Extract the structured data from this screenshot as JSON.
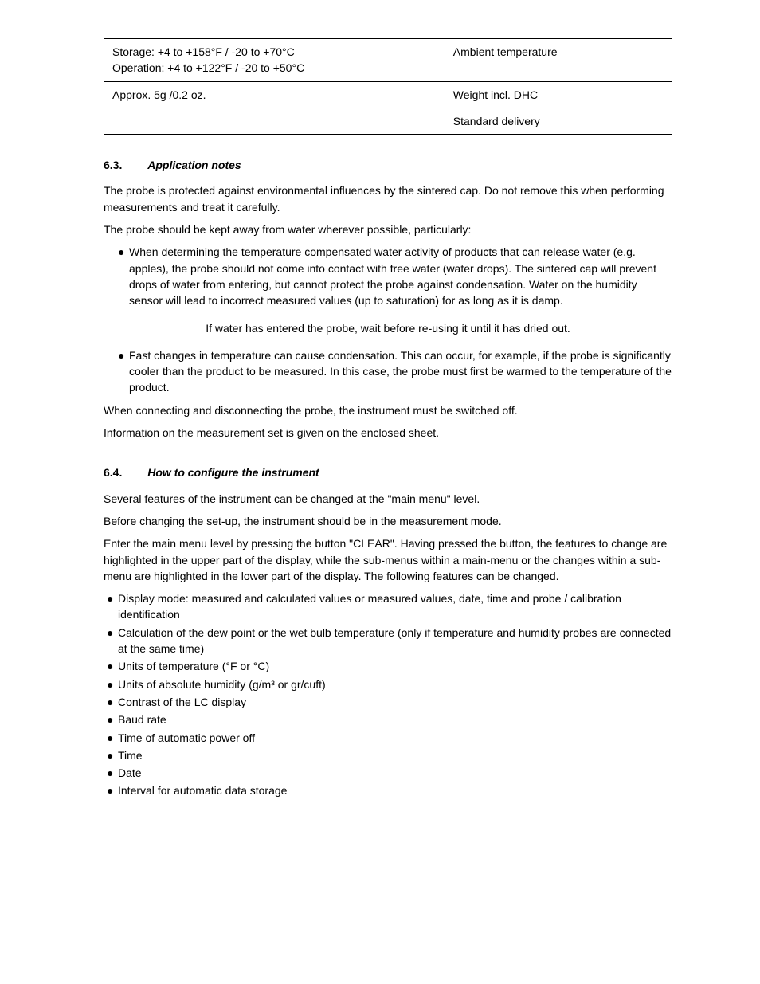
{
  "table": {
    "rows": [
      {
        "left": "Storage: +4 to +158°F / -20 to +70°C\nOperation: +4 to +122°F / -20 to +50°C",
        "right": "Ambient temperature",
        "leftRowspan": 1,
        "rightRowspan": 1
      },
      {
        "left": "Approx. 5g /0.2 oz.",
        "right": "Weight incl. DHC",
        "leftRowspan": 2
      },
      {
        "right": "Standard delivery"
      }
    ]
  },
  "sections": [
    {
      "num": "6.3.",
      "title": "Application notes",
      "paras": [
        "The probe is protected against environmental influences by the sintered cap. Do not remove this when performing measurements and treat it carefully.",
        "The probe should be kept away from water wherever possible, particularly:"
      ],
      "bullets": [
        "When determining the temperature compensated water activity of products that can release water (e.g. apples), the probe should not come into contact with free water (water drops). The sintered cap will prevent drops of water from entering, but cannot protect the probe against condensation. Water on the humidity sensor will lead to incorrect measured values (up to saturation) for as long as it is damp."
      ],
      "bulletsB": [
        "Fast changes in temperature can cause condensation. This can occur, for example, if the probe is significantly cooler than the product to be measured. In this case, the probe must first be warmed to the temperature of the product."
      ],
      "parasAfter": [
        "When connecting and disconnecting the probe, the instrument must be switched off.",
        "Information on the measurement set is given on the enclosed sheet."
      ]
    },
    {
      "num": "6.4.",
      "title": "How to configure the instrument",
      "paras": [
        "Several features of the instrument can be changed at the \"main menu\" level.",
        "Before changing the set-up, the instrument should be in the measurement mode.",
        "Enter the main menu level by pressing the button \"CLEAR\". Having pressed the button, the features to change are highlighted in the upper part of the display, while the sub-menus within a main-menu or the changes within a sub-menu are highlighted in the lower part of the display. The following features can be changed."
      ],
      "simpleBullets": [
        "Display mode: measured and calculated values or measured values, date, time and probe / calibration identification",
        "Calculation of the dew point or the wet bulb temperature (only if temperature and humidity probes are connected at the same time)",
        "Units of temperature (°F or °C)",
        "Units of absolute humidity (g/m³ or gr/cuft)",
        "Contrast of the LC display",
        "Baud rate",
        "Time of automatic power off",
        "Time",
        "Date",
        "Interval for automatic data storage"
      ]
    }
  ]
}
